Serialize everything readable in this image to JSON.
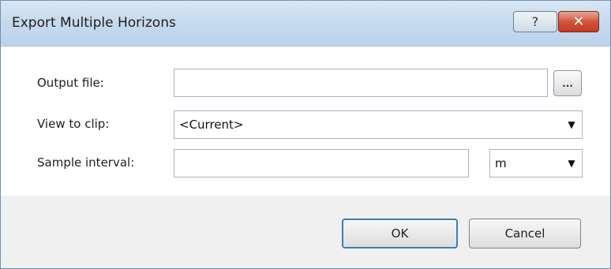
{
  "window": {
    "title": "Export Multiple Horizons",
    "help_glyph": "?",
    "close_glyph": "✕"
  },
  "form": {
    "output_file": {
      "label": "Output file:",
      "value": "",
      "browse_label": "..."
    },
    "view_to_clip": {
      "label": "View to clip:",
      "value": "<Current>"
    },
    "sample_interval": {
      "label": "Sample interval:",
      "value": "",
      "unit": "m"
    }
  },
  "footer": {
    "ok_label": "OK",
    "cancel_label": "Cancel"
  },
  "icons": {
    "dropdown": "chevron-down-icon"
  }
}
